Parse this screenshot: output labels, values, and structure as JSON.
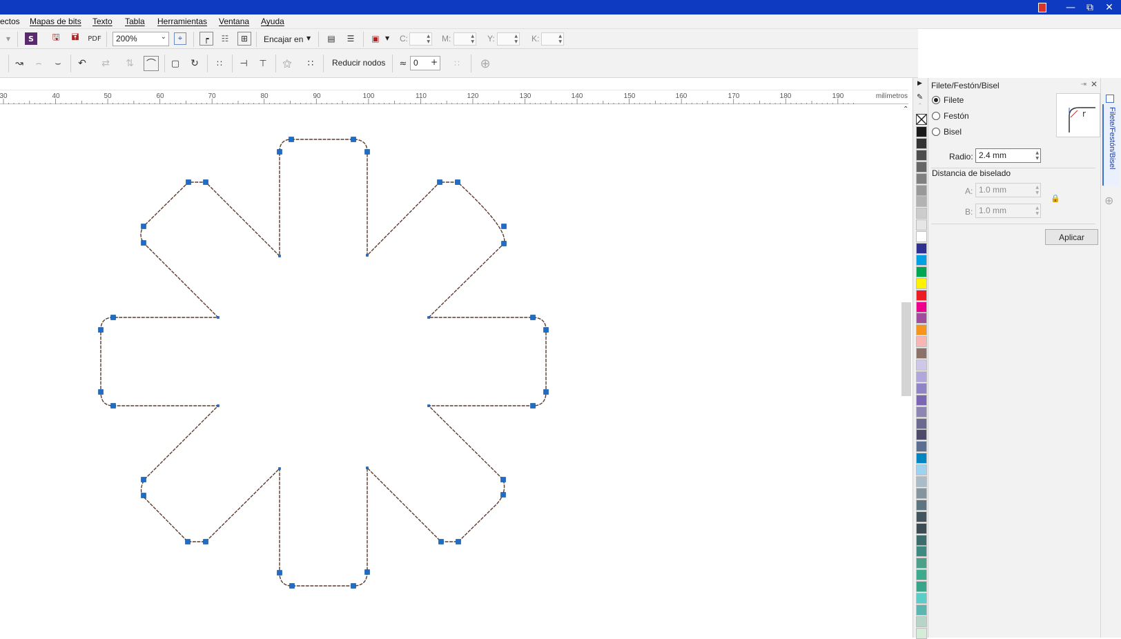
{
  "menu": {
    "items": [
      "ectos",
      "Mapas de bits",
      "Texto",
      "Tabla",
      "Herramientas",
      "Ventana",
      "Ayuda"
    ]
  },
  "toolbar": {
    "zoom_value": "200%",
    "snap_label": "Encajar en",
    "c_label": "C:",
    "m_label": "M:",
    "y_label": "Y:",
    "k_label": "K:"
  },
  "property_bar": {
    "reduce_nodes_label": "Reducir nodos",
    "smoothing_value": "0"
  },
  "ruler": {
    "ticks": [
      "30",
      "40",
      "50",
      "60",
      "70",
      "80",
      "90",
      "100",
      "110",
      "120",
      "130",
      "140",
      "150",
      "160",
      "170",
      "180",
      "190"
    ],
    "unit": "milímetros"
  },
  "docker": {
    "title": "Filete/Festón/Bisel",
    "options": [
      "Filete",
      "Festón",
      "Bisel"
    ],
    "selected_option": "Filete",
    "radius_label": "Radio:",
    "radius_value": "2.4 mm",
    "bevel_section_label": "Distancia de biselado",
    "a_label": "A:",
    "a_value": "1.0 mm",
    "b_label": "B:",
    "b_value": "1.0 mm",
    "apply_label": "Aplicar",
    "tab_label": "Filete/Festón/Bisel"
  },
  "palette": {
    "colors": [
      "#1a1a1a",
      "#333333",
      "#4d4d4d",
      "#666666",
      "#808080",
      "#999999",
      "#b3b3b3",
      "#cccccc",
      "#e6e6e6",
      "#ffffff",
      "#2e3192",
      "#00a0e4",
      "#00a651",
      "#fff200",
      "#ed1c24",
      "#ec008c",
      "#a04d9b",
      "#f7941d",
      "#f9b4b4",
      "#8c7168",
      "#cfc7e8",
      "#b2a7db",
      "#8e84c6",
      "#7a66b2",
      "#8d86b3",
      "#6d6a8f",
      "#4d4a6a",
      "#5b6f92",
      "#0086c1",
      "#9dd3f0",
      "#a9bcc8",
      "#8495a0",
      "#5e7480",
      "#44545d",
      "#3d4c52",
      "#3d6d6a",
      "#3e8a80",
      "#4ba08a",
      "#3eaa8d",
      "#38a589",
      "#59cdc8",
      "#5ab7b0",
      "#b6d5c9",
      "#d5ecd9"
    ]
  },
  "accent": "#0e3ac2",
  "shape_stroke": "#5b3a2e",
  "node_color": "#1e6ec8"
}
